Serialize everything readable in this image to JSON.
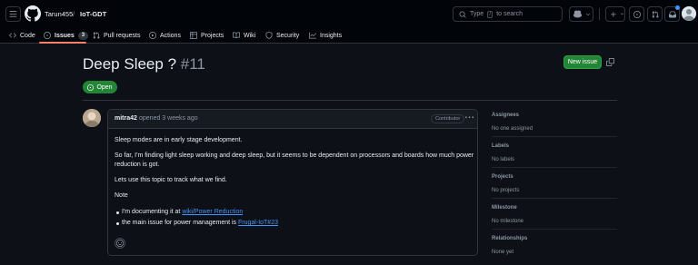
{
  "header": {
    "owner": "Tarun455",
    "separator": "/",
    "repo": "IoT-GDT",
    "search": {
      "prefix": "Type",
      "shortcut": "/",
      "suffix": "to search"
    }
  },
  "tabs": [
    {
      "label": "Code",
      "icon": "code-icon"
    },
    {
      "label": "Issues",
      "icon": "issue-opened-icon",
      "count": "3",
      "active": true
    },
    {
      "label": "Pull requests",
      "icon": "git-pull-request-icon"
    },
    {
      "label": "Actions",
      "icon": "play-icon"
    },
    {
      "label": "Projects",
      "icon": "table-icon"
    },
    {
      "label": "Wiki",
      "icon": "book-icon"
    },
    {
      "label": "Security",
      "icon": "shield-icon"
    },
    {
      "label": "Insights",
      "icon": "graph-icon"
    }
  ],
  "issue": {
    "title": "Deep Sleep ?",
    "number": "#11",
    "new_issue_label": "New issue",
    "status": "Open"
  },
  "comment": {
    "author": "mitra42",
    "opened": "opened 3 weeks ago",
    "role": "Contributor",
    "paragraphs": [
      "Sleep modes are in early stage development.",
      "So far, I'm finding light sleep working and deep sleep, but it seems to be dependent on processors and boards how much power",
      "reduction is got.",
      "Lets use this topic to track what we find.",
      "Note"
    ],
    "bullets": [
      {
        "text": "I'm documenting it at ",
        "link": "wiki/Power Reduction"
      },
      {
        "text": "the main issue for power management is ",
        "link": "Frugal-IoT#23"
      }
    ]
  },
  "sidebar": [
    {
      "heading": "Assignees",
      "value": "No one assigned"
    },
    {
      "heading": "Labels",
      "value": "No labels"
    },
    {
      "heading": "Projects",
      "value": "No projects"
    },
    {
      "heading": "Milestone",
      "value": "No milestone"
    },
    {
      "heading": "Relationships",
      "value": "None yet"
    }
  ],
  "colors": {
    "background": "#0d1117",
    "header": "#010409",
    "open_green": "#238636",
    "link_blue": "#4493f8",
    "active_tab_underline": "#f78166"
  }
}
